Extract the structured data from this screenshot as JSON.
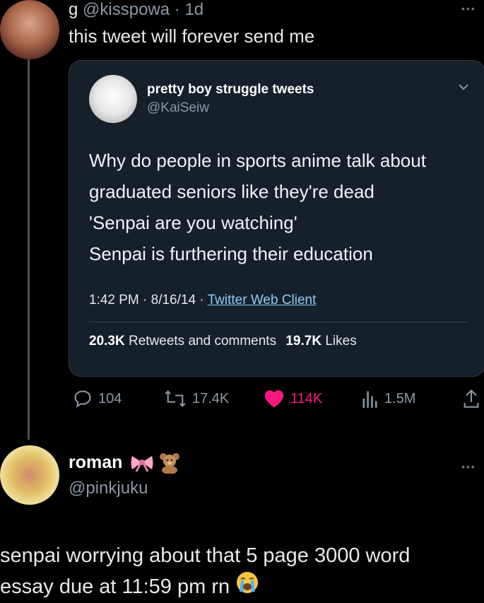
{
  "tweet": {
    "display_name": "g",
    "handle": "@kisspowa",
    "time": "· 1d",
    "text": "this tweet will forever send me"
  },
  "quoted": {
    "display_name": "pretty boy struggle tweets",
    "handle": "@KaiSeiw",
    "lines": [
      "Why do people in sports anime talk about",
      "graduated seniors like they're dead",
      "'Senpai are you watching'",
      "Senpai is furthering their education"
    ],
    "timestamp": "1:42 PM · 8/16/14 ·",
    "client": "Twitter Web Client",
    "retweets_count": "20.3K",
    "retweets_label": "Retweets and comments",
    "likes_count": "19.7K",
    "likes_label": "Likes"
  },
  "actions": {
    "replies": "104",
    "retweets": "17.4K",
    "likes": "114K",
    "views": "1.5M"
  },
  "reply": {
    "display_name": "roman",
    "handle": "@pinkjuku",
    "text_line1": "senpai worrying about that 5 page 3000 word",
    "text_line2": "essay due at 11:59 pm rn"
  },
  "icons": {
    "reply": "speech-bubble-icon",
    "retweet": "retweet-arrows-icon",
    "like": "heart-icon",
    "views": "bar-chart-icon",
    "share": "share-arrow-icon"
  },
  "colors": {
    "like": "#f91880",
    "link": "#8ecdf8",
    "card": "#15202b"
  }
}
